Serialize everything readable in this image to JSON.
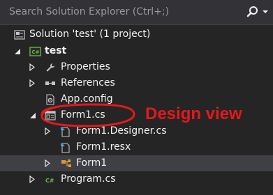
{
  "search": {
    "placeholder": "Search Solution Explorer (Ctrl+;)",
    "icon": "search-icon"
  },
  "tree": {
    "solution": "Solution 'test' (1 project)",
    "project": "test",
    "properties": "Properties",
    "references": "References",
    "app_config": "App.config",
    "form1_cs": "Form1.cs",
    "form1_designer": "Form1.Designer.cs",
    "form1_resx": "Form1.resx",
    "form1": "Form1",
    "program": "Program.cs"
  },
  "annotation": {
    "text": "Design view",
    "color": "#e3191b"
  },
  "colors": {
    "background": "#252526",
    "selected_row": "#3f3f46",
    "csharp_green": "#6fb04a",
    "cs_file_blue": "#4f9bd8"
  }
}
